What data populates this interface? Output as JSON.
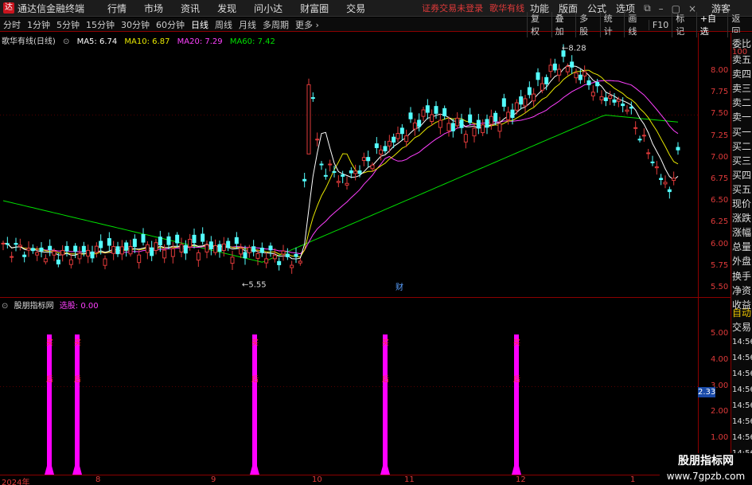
{
  "app": {
    "title": "通达信金融终端",
    "logo_glyph": "达",
    "menu": [
      "行情",
      "市场",
      "资讯",
      "发现",
      "问小达",
      "财富圈",
      "交易"
    ],
    "login_status": "证券交易未登录",
    "stock_title": "歌华有线",
    "right_menu": [
      "功能",
      "版面",
      "公式",
      "选项"
    ],
    "window_controls": [
      "⧉",
      "–",
      "▢",
      "×"
    ],
    "guest": "游客"
  },
  "toolbar": {
    "periods": [
      "分时",
      "1分钟",
      "5分钟",
      "15分钟",
      "30分钟",
      "60分钟",
      "日线",
      "周线",
      "月线",
      "多周期",
      "更多 ›"
    ],
    "active_period": "日线",
    "buttons": [
      "复权",
      "叠加",
      "多股",
      "统计",
      "画线",
      "F10",
      "标记",
      "+自选",
      "返回"
    ]
  },
  "legend": {
    "name": "歌华有线(日线)",
    "ma5": "MA5: 6.74",
    "ma10": "MA10: 6.87",
    "ma20": "MA20: 7.29",
    "ma60": "MA60: 7.42"
  },
  "sub_legend": {
    "name": "股朋指标网",
    "label": "选股: 0.00"
  },
  "colors": {
    "up": "#e03a3a",
    "down": "#54ffff",
    "ma5": "#ffffff",
    "ma10": "#e8e800",
    "ma20": "#ff40ff",
    "ma60": "#00e000",
    "signal": "#ff00ff"
  },
  "price_axis": [
    "8.00",
    "7.75",
    "7.50",
    "7.25",
    "7.00",
    "6.75",
    "6.50",
    "6.25",
    "6.00",
    "5.75",
    "5.50"
  ],
  "sub_axis": [
    "5.00",
    "4.00",
    "3.00",
    "2.00",
    "1.00"
  ],
  "annotations": {
    "high": "8.28",
    "low": "5.55",
    "fin": "财"
  },
  "signals": {
    "glyph_top": "买",
    "glyph_bottom": "后",
    "count": 5
  },
  "current_value": "2.33",
  "date_axis": [
    "2024年",
    "8",
    "9",
    "10",
    "11",
    "12",
    "1"
  ],
  "right_panel": {
    "items": [
      "委比",
      "卖五",
      "卖四",
      "卖三",
      "卖二",
      "卖一",
      "买一",
      "买二",
      "买三",
      "买四",
      "买五",
      "现价",
      "涨跌",
      "涨幅",
      "总量",
      "外盘",
      "换手",
      "净资",
      "收益"
    ],
    "small_top": "100",
    "auto": "自动",
    "trade": "交易",
    "times": [
      "14:56",
      "14:56",
      "14:56",
      "14:56",
      "14:56",
      "14:56",
      "14:56",
      "14:56",
      "14:56"
    ]
  },
  "watermark": {
    "line1": "股朋指标网",
    "line2": "www.7gpzb.com"
  }
}
